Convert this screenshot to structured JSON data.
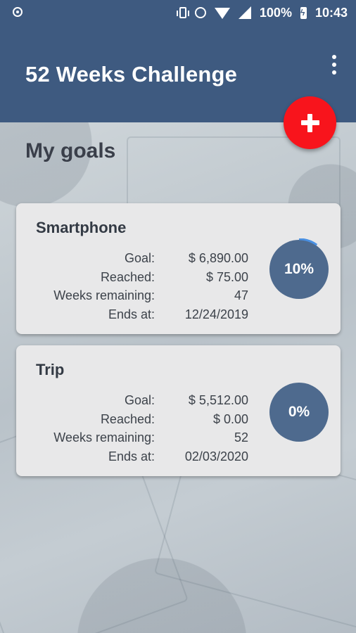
{
  "statusbar": {
    "battery": "100%",
    "time": "10:43"
  },
  "appbar": {
    "title": "52 Weeks Challenge"
  },
  "main": {
    "section_title": "My goals",
    "goals": [
      {
        "name": "Smartphone",
        "labels": {
          "goal": "Goal:",
          "reached": "Reached:",
          "weeks": "Weeks remaining:",
          "ends": "Ends at:"
        },
        "goal": "$ 6,890.00",
        "reached": "$ 75.00",
        "weeks_remaining": "47",
        "ends_at": "12/24/2019",
        "progress_label": "10%",
        "progress": 0.1
      },
      {
        "name": "Trip",
        "labels": {
          "goal": "Goal:",
          "reached": "Reached:",
          "weeks": "Weeks remaining:",
          "ends": "Ends at:"
        },
        "goal": "$ 5,512.00",
        "reached": "$ 0.00",
        "weeks_remaining": "52",
        "ends_at": "02/03/2020",
        "progress_label": "0%",
        "progress": 0
      }
    ]
  },
  "colors": {
    "primary": "#3e5a80",
    "fab": "#f8141c",
    "ring": "#4e6a8e",
    "progress_arc": "#4a90e2"
  }
}
